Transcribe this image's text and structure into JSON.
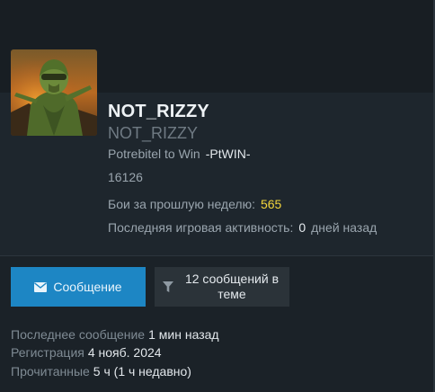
{
  "profile": {
    "username": "NOT_RIZZY",
    "subname": "NOT_RIZZY",
    "title": "Potrebitel to Win",
    "title_tag": "-PtWIN-",
    "user_id": "16126",
    "fights_label": "Бои за прошлую неделю:",
    "fights_value": "565",
    "activity_label": "Последняя игровая активность:",
    "activity_value": "0",
    "activity_suffix": "дней назад"
  },
  "actions": {
    "message_label": "Сообщение",
    "message_icon": "envelope-icon",
    "filter_label": "12 сообщений в теме",
    "filter_icon": "funnel-icon"
  },
  "info": {
    "last_message_label": "Последнее сообщение",
    "last_message_value": "1 мин назад",
    "registration_label": "Регистрация",
    "registration_value": "4 нояб. 2024",
    "read_label": "Прочитанные",
    "read_value": "5 ч (1 ч недавно)"
  },
  "colors": {
    "accent": "#1d86c4",
    "highlight": "#f3d53c",
    "background": "#1b2228"
  }
}
